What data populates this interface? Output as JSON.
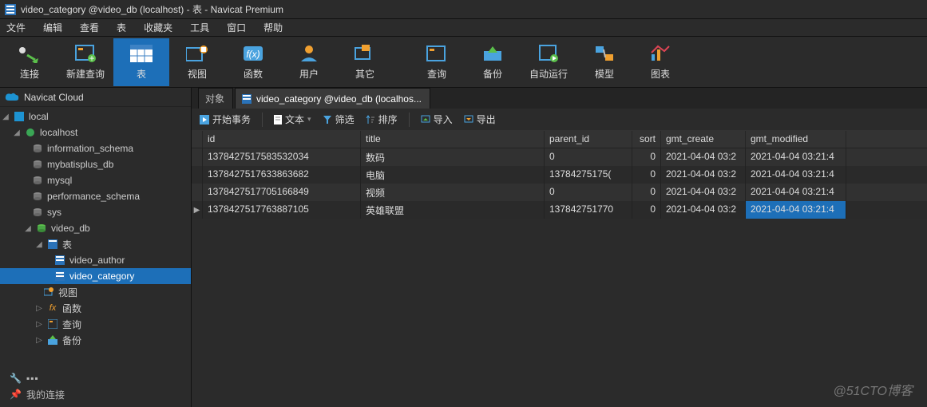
{
  "window": {
    "title": "video_category @video_db (localhost) - 表 - Navicat Premium"
  },
  "menus": [
    "文件",
    "编辑",
    "查看",
    "表",
    "收藏夹",
    "工具",
    "窗口",
    "帮助"
  ],
  "toolbar": [
    {
      "id": "connect",
      "label": "连接"
    },
    {
      "id": "newquery",
      "label": "新建查询"
    },
    {
      "id": "table",
      "label": "表",
      "active": true
    },
    {
      "id": "view",
      "label": "视图"
    },
    {
      "id": "fx",
      "label": "函数"
    },
    {
      "id": "user",
      "label": "用户"
    },
    {
      "id": "other",
      "label": "其它"
    },
    {
      "id": "query",
      "label": "查询"
    },
    {
      "id": "backup",
      "label": "备份"
    },
    {
      "id": "auto",
      "label": "自动运行"
    },
    {
      "id": "model",
      "label": "模型"
    },
    {
      "id": "chart",
      "label": "图表"
    }
  ],
  "sidebar": {
    "header": "Navicat Cloud",
    "nodes": {
      "local": "local",
      "localhost": "localhost",
      "information_schema": "information_schema",
      "mybatisplus_db": "mybatisplus_db",
      "mysql": "mysql",
      "performance_schema": "performance_schema",
      "sys": "sys",
      "video_db": "video_db",
      "tables": "表",
      "video_author": "video_author",
      "video_category": "video_category",
      "views": "视图",
      "functions": "函数",
      "queries": "查询",
      "backups": "备份"
    },
    "footer": {
      "row1": "",
      "row2": "我的连接"
    }
  },
  "tabs": {
    "obj": "对象",
    "open": "video_category @video_db (localhos..."
  },
  "tabtools": {
    "begin": "开始事务",
    "text": "文本",
    "filter": "筛选",
    "sort": "排序",
    "import": "导入",
    "export": "导出"
  },
  "grid": {
    "columns": [
      "id",
      "title",
      "parent_id",
      "sort",
      "gmt_create",
      "gmt_modified"
    ],
    "rows": [
      {
        "id": "1378427517583532034",
        "title": "数码",
        "parent_id": "0",
        "sort": "0",
        "gmt_create": "2021-04-04 03:2",
        "gmt_modified": "2021-04-04 03:21:4"
      },
      {
        "id": "1378427517633863682",
        "title": "电脑",
        "parent_id": "13784275175(",
        "sort": "0",
        "gmt_create": "2021-04-04 03:2",
        "gmt_modified": "2021-04-04 03:21:4"
      },
      {
        "id": "1378427517705166849",
        "title": "视频",
        "parent_id": "0",
        "sort": "0",
        "gmt_create": "2021-04-04 03:2",
        "gmt_modified": "2021-04-04 03:21:4"
      },
      {
        "id": "1378427517763887105",
        "title": "英雄联盟",
        "parent_id": "137842751770",
        "sort": "0",
        "gmt_create": "2021-04-04 03:2",
        "gmt_modified": "2021-04-04 03:21:4",
        "current": true,
        "selcol": "gmt_modified"
      }
    ]
  },
  "watermark": "@51CTO博客"
}
